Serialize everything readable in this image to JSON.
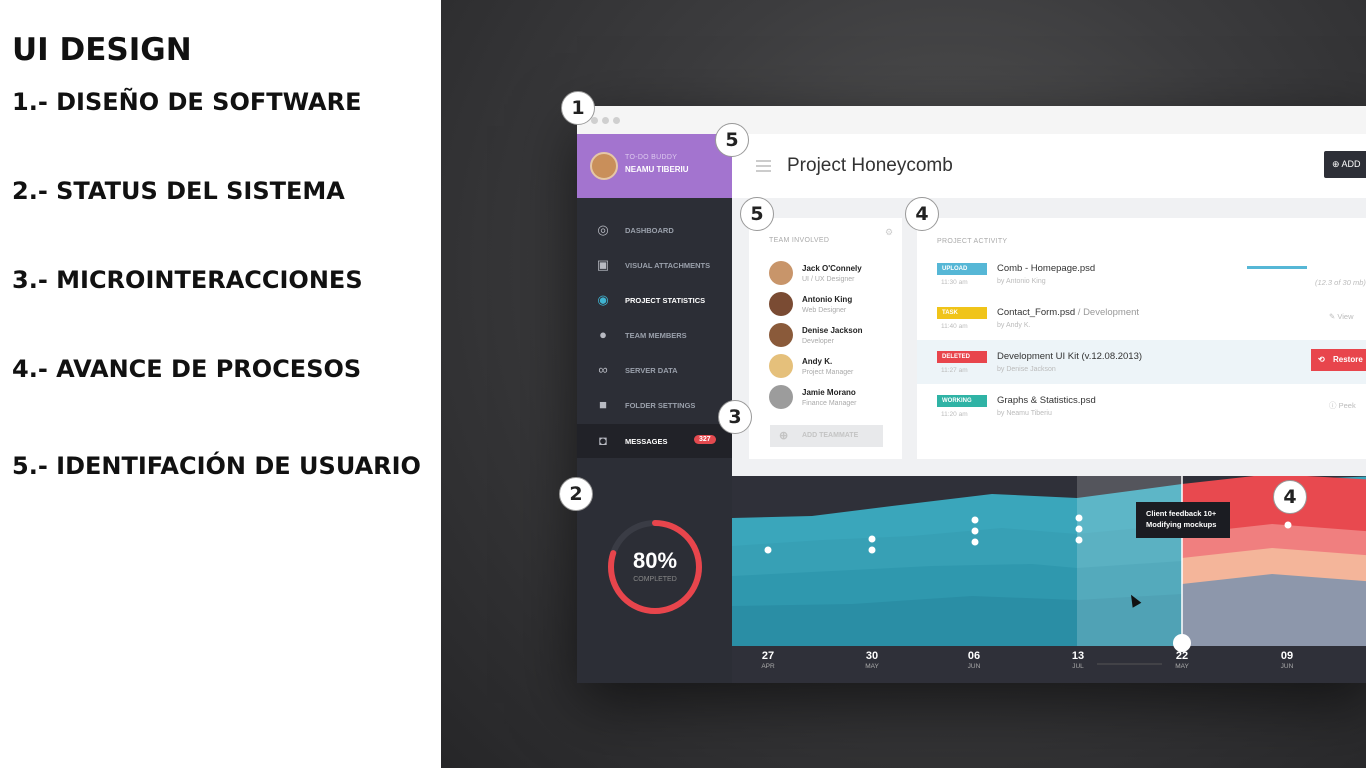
{
  "slide": {
    "title": "UI DESIGN",
    "items": [
      "1.- DISEÑO DE SOFTWARE",
      "2.- STATUS DEL SISTEMA",
      "3.- MICROINTERACCIONES",
      "4.- AVANCE DE PROCESOS",
      "5.- IDENTIFACIÓN DE USUARIO"
    ]
  },
  "app": {
    "profile": {
      "caption": "TO-DO BUDDY",
      "name": "NEAMU TIBERIU"
    },
    "nav": [
      {
        "label": "DASHBOARD",
        "icon": "dashboard-icon"
      },
      {
        "label": "VISUAL ATTACHMENTS",
        "icon": "image-icon"
      },
      {
        "label": "PROJECT STATISTICS",
        "icon": "eye-icon"
      },
      {
        "label": "TEAM MEMBERS",
        "icon": "user-icon"
      },
      {
        "label": "SERVER DATA",
        "icon": "infinity-icon"
      },
      {
        "label": "FOLDER SETTINGS",
        "icon": "folder-icon"
      },
      {
        "label": "MESSAGES",
        "icon": "inbox-icon",
        "badge": "327"
      }
    ],
    "header": {
      "title": "Project Honeycomb",
      "add_label": "ADD"
    },
    "team": {
      "label": "TEAM INVOLVED",
      "members": [
        {
          "name": "Jack O'Connely",
          "role": "UI / UX Designer"
        },
        {
          "name": "Antonio King",
          "role": "Web Designer"
        },
        {
          "name": "Denise Jackson",
          "role": "Developer"
        },
        {
          "name": "Andy K.",
          "role": "Project Manager"
        },
        {
          "name": "Jamie Morano",
          "role": "Finance Manager"
        }
      ],
      "add_label": "ADD TEAMMATE"
    },
    "activity": {
      "label": "PROJECT ACTIVITY",
      "rows": [
        {
          "tag": "UPLOAD",
          "time": "11:30 am",
          "file": "Comb - Homepage.psd",
          "sub": "",
          "by": "by Antonio King",
          "right": "(12.3 of 30 mb)",
          "progress": 0.7
        },
        {
          "tag": "TASK",
          "time": "11:40 am",
          "file": "Contact_Form.psd",
          "sub": "/ Development",
          "by": "by Andy K.",
          "right": "View"
        },
        {
          "tag": "DELETED",
          "time": "11:27 am",
          "file": "Development UI Kit (v.12.08.2013)",
          "sub": "",
          "by": "by Denise Jackson",
          "right": "Restore"
        },
        {
          "tag": "WORKING",
          "time": "11:20 am",
          "file": "Graphs & Statistics.psd",
          "sub": "",
          "by": "by Neamu Tiberiu",
          "right": "Peek"
        }
      ]
    },
    "status": {
      "percent": "80%",
      "label": "COMPLETED",
      "value": 0.8
    },
    "timeline": {
      "tooltip": [
        "Client feedback 10+",
        "Modifying mockups"
      ],
      "ticks": [
        {
          "d": "27",
          "m": "APR"
        },
        {
          "d": "30",
          "m": "MAY"
        },
        {
          "d": "06",
          "m": "JUN"
        },
        {
          "d": "13",
          "m": "JUL"
        },
        {
          "d": "22",
          "m": "MAY"
        },
        {
          "d": "09",
          "m": "JUN"
        }
      ]
    }
  },
  "callouts": [
    "1",
    "5",
    "5",
    "4",
    "3",
    "2",
    "4"
  ],
  "colors": {
    "sidebar": "#2c2e36",
    "profile": "#a374cf",
    "teal": "#3ea7bd",
    "red": "#e8454c",
    "upload": "#56b7d6",
    "task": "#f0c419",
    "working": "#2fb3a5"
  }
}
